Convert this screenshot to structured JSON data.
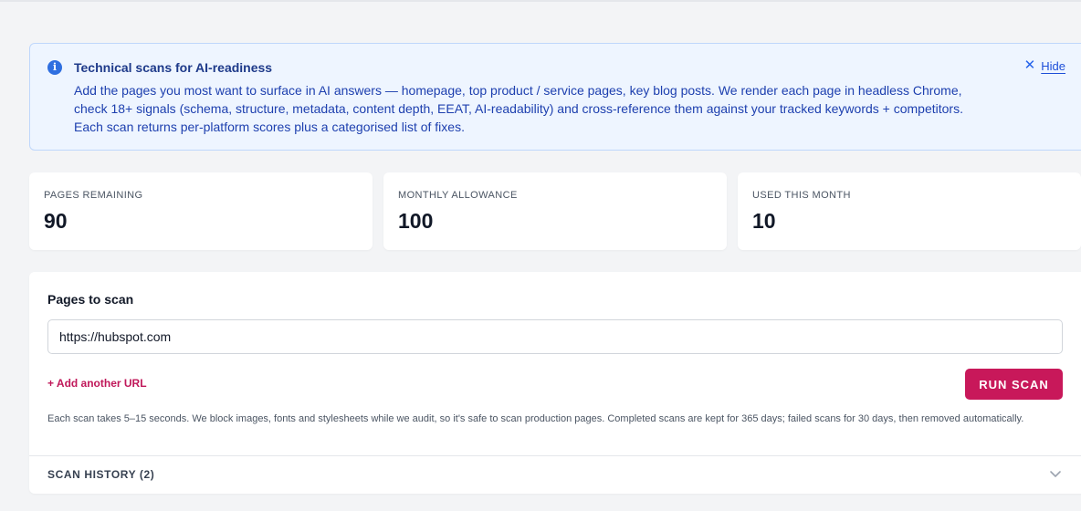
{
  "banner": {
    "title": "Technical scans for AI-readiness",
    "body": "Add the pages you most want to surface in AI answers — homepage, top product / service pages, key blog posts. We render each page in headless Chrome, check 18+ signals (schema, structure, metadata, content depth, EEAT, AI-readability) and cross-reference them against your tracked keywords + competitors. Each scan returns per-platform scores plus a categorised list of fixes.",
    "hide_label": "Hide",
    "info_icon": "info-icon",
    "close_icon": "close-icon"
  },
  "stats": [
    {
      "label": "PAGES REMAINING",
      "value": "90"
    },
    {
      "label": "MONTHLY ALLOWANCE",
      "value": "100"
    },
    {
      "label": "USED THIS MONTH",
      "value": "10"
    }
  ],
  "scan": {
    "title": "Pages to scan",
    "url_value": "https://hubspot.com",
    "add_url_label": "+ Add another URL",
    "run_label": "RUN SCAN",
    "help_text": "Each scan takes 5–15 seconds. We block images, fonts and stylesheets while we audit, so it's safe to scan production pages. Completed scans are kept for 365 days; failed scans for 30 days, then removed automatically.",
    "history_label": "SCAN HISTORY (2)",
    "history_icon": "chevron-down-icon"
  },
  "colors": {
    "accent": "#c8185a",
    "info_blue": "#2f6fe0",
    "banner_bg": "#eef5ff"
  }
}
